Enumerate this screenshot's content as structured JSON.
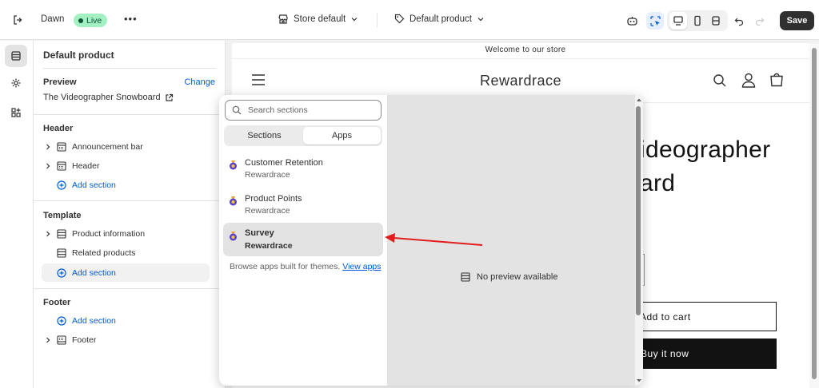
{
  "topbar": {
    "theme_name": "Dawn",
    "live_badge": "Live",
    "more_label": "•••",
    "store_label": "Store default",
    "template_label": "Default product",
    "save_label": "Save"
  },
  "sidebar": {
    "title": "Default product",
    "preview_label": "Preview",
    "change_label": "Change",
    "preview_product": "The Videographer Snowboard",
    "header_group": {
      "label": "Header",
      "items": [
        "Announcement bar",
        "Header"
      ],
      "add_label": "Add section"
    },
    "template_group": {
      "label": "Template",
      "items": [
        "Product information",
        "Related products"
      ],
      "add_label": "Add section"
    },
    "footer_group": {
      "label": "Footer",
      "add_label": "Add section",
      "items": [
        "Footer"
      ]
    }
  },
  "picker": {
    "search_placeholder": "Search sections",
    "tabs": [
      "Sections",
      "Apps"
    ],
    "active_tab": "Apps",
    "apps": [
      {
        "name": "Customer Retention",
        "vendor": "Rewardrace"
      },
      {
        "name": "Product Points",
        "vendor": "Rewardrace"
      },
      {
        "name": "Survey",
        "vendor": "Rewardrace"
      }
    ],
    "selected_app": "Survey",
    "browse_text": "Browse apps built for themes.",
    "browse_link": "View apps",
    "no_preview": "No preview available"
  },
  "store_preview": {
    "announcement": "Welcome to our store",
    "logo": "Rewardrace",
    "title_line1": "ideographer",
    "title_line2": "ard",
    "add_to_cart": "Add to cart",
    "buy_now": "Buy it now"
  },
  "colors": {
    "accent_link": "#005bd3",
    "live_badge_bg": "#a3f0c2",
    "save_bg": "#303030",
    "annotation_arrow": "#e11d1d"
  }
}
